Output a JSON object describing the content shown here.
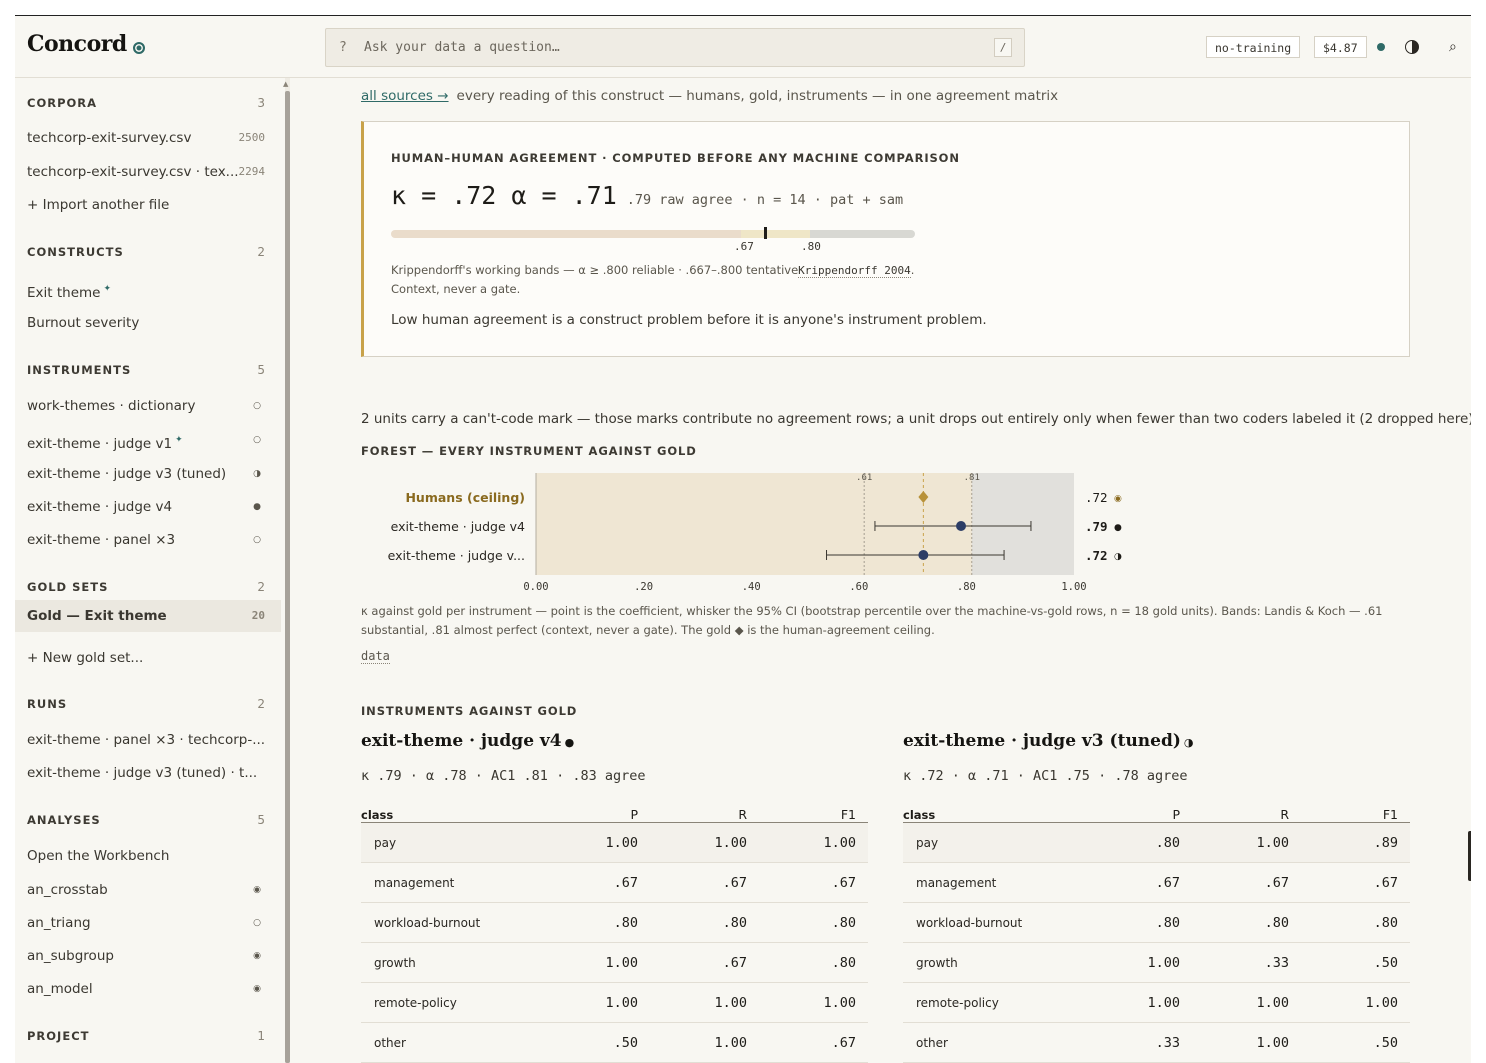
{
  "header": {
    "logo": "Concord",
    "search_prefix": "?",
    "search_placeholder": "Ask your data a question…",
    "search_shortcut": "/",
    "privacy_chip": "no-training",
    "cost_chip": "$4.87",
    "status_color": "#2f6a67"
  },
  "sidebar": {
    "sections": [
      {
        "title": "CORPORA",
        "count": "3",
        "items": [
          {
            "label": "techcorp-exit-survey.csv",
            "count": "2500"
          },
          {
            "label": "techcorp-exit-survey.csv · tex...",
            "count": "2294"
          },
          {
            "label": "+ Import another file"
          }
        ]
      },
      {
        "title": "CONSTRUCTS",
        "count": "2",
        "items": [
          {
            "label": "Exit theme",
            "star": "✦"
          },
          {
            "label": "Burnout severity"
          }
        ]
      },
      {
        "title": "INSTRUMENTS",
        "count": "5",
        "items": [
          {
            "label": "work-themes · dictionary",
            "indicator": "○"
          },
          {
            "label": "exit-theme · judge v1",
            "star": "✦",
            "indicator": "○"
          },
          {
            "label": "exit-theme · judge v3 (tuned)",
            "indicator": "◑"
          },
          {
            "label": "exit-theme · judge v4",
            "indicator": "●"
          },
          {
            "label": "exit-theme · panel ×3",
            "indicator": "○"
          }
        ]
      },
      {
        "title": "GOLD SETS",
        "count": "2",
        "items": [
          {
            "label": "Gold — Exit theme",
            "count": "20",
            "active": true
          },
          {
            "label": "+ New gold set..."
          }
        ]
      },
      {
        "title": "RUNS",
        "count": "2",
        "items": [
          {
            "label": "exit-theme · panel ×3 · techcorp-..."
          },
          {
            "label": "exit-theme · judge v3 (tuned) · t..."
          }
        ]
      },
      {
        "title": "ANALYSES",
        "count": "5",
        "items": [
          {
            "label": "Open the Workbench"
          },
          {
            "label": "an_crosstab",
            "indicator": "◉"
          },
          {
            "label": "an_triang",
            "indicator": "○"
          },
          {
            "label": "an_subgroup",
            "indicator": "◉"
          },
          {
            "label": "an_model",
            "indicator": "◉"
          }
        ]
      },
      {
        "title": "PROJECT",
        "count": "1",
        "items": []
      }
    ]
  },
  "main": {
    "breadcrumb_link": "all sources →",
    "breadcrumb_text": "every reading of this construct — humans, gold, instruments — in one agreement matrix",
    "agreement": {
      "title": "HUMAN–HUMAN AGREEMENT · COMPUTED BEFORE ANY MACHINE COMPARISON",
      "kappa_alpha": "κ = .72 α = .71",
      "sub": ".79 raw agree · n = 14 · pat + sam",
      "value": 0.72,
      "band_low": 0.667,
      "band_high": 0.8,
      "tick_low": ".67",
      "tick_high": ".80",
      "note": "Krippendorff's working bands — α ≥ .800 reliable · .667–.800 tentative",
      "citation": "Krippendorff 2004",
      "note_tail": ".",
      "note2": "Context, never a gate.",
      "message": "Low human agreement is a construct problem before it is anyone's instrument problem."
    },
    "cantcode_note": "2 units carry a can't-code mark — those marks contribute no agreement rows; a unit drops out entirely only when fewer than two coders labeled it (2 dropped here).",
    "forest_title": "FOREST — EVERY INSTRUMENT AGAINST GOLD",
    "forest_caption": "κ against gold per instrument — point is the coefficient, whisker the 95% CI (bootstrap percentile over the machine-vs-gold rows, n = 18 gold units). Bands: Landis & Koch — .61 substantial, .81 almost perfect (context, never a gate). The gold ◆ is the human-agreement ceiling.",
    "data_link": "data",
    "instruments_title": "INSTRUMENTS AGAINST GOLD",
    "instruments": [
      {
        "name": "exit-theme · judge v4",
        "indicator": "●",
        "stats": "κ .79 · α .78 · AC1 .81 · .83 agree",
        "headers": [
          "class",
          "P",
          "R",
          "F1"
        ],
        "rows": [
          [
            "pay",
            "1.00",
            "1.00",
            "1.00"
          ],
          [
            "management",
            ".67",
            ".67",
            ".67"
          ],
          [
            "workload-burnout",
            ".80",
            ".80",
            ".80"
          ],
          [
            "growth",
            "1.00",
            ".67",
            ".80"
          ],
          [
            "remote-policy",
            "1.00",
            "1.00",
            "1.00"
          ],
          [
            "other",
            ".50",
            "1.00",
            ".67"
          ]
        ]
      },
      {
        "name": "exit-theme · judge v3 (tuned)",
        "indicator": "◑",
        "stats": "κ .72 · α .71 · AC1 .75 · .78 agree",
        "headers": [
          "class",
          "P",
          "R",
          "F1"
        ],
        "rows": [
          [
            "pay",
            ".80",
            "1.00",
            ".89"
          ],
          [
            "management",
            ".67",
            ".67",
            ".67"
          ],
          [
            "workload-burnout",
            ".80",
            ".80",
            ".80"
          ],
          [
            "growth",
            "1.00",
            ".33",
            ".50"
          ],
          [
            "remote-policy",
            "1.00",
            "1.00",
            "1.00"
          ],
          [
            "other",
            ".33",
            "1.00",
            ".50"
          ]
        ]
      }
    ]
  },
  "chart_data": {
    "type": "scatter",
    "title": "FOREST — EVERY INSTRUMENT AGAINST GOLD",
    "xlim": [
      0,
      1
    ],
    "x_ticks": [
      "0.00",
      ".20",
      ".40",
      ".60",
      ".80",
      "1.00"
    ],
    "reference_lines": [
      {
        "x": 0.61,
        "label": ".61"
      },
      {
        "x": 0.81,
        "label": ".81"
      }
    ],
    "bands": [
      {
        "from": 0,
        "to": 0.81,
        "color": "#efe6d3"
      },
      {
        "from": 0.81,
        "to": 1.0,
        "color": "#e1e0dc"
      }
    ],
    "ceiling_line": 0.72,
    "rows": [
      {
        "label": "Humans (ceiling)",
        "value": 0.72,
        "value_label": ".72",
        "marker": "diamond",
        "indicator": "◉",
        "color": "#b8923a",
        "label_color": "#8a6a1f"
      },
      {
        "label": "exit-theme · judge v4",
        "value": 0.79,
        "ci": [
          0.63,
          0.92
        ],
        "value_label": ".79",
        "marker": "circle",
        "indicator": "●",
        "color": "#2c3d66"
      },
      {
        "label": "exit-theme · judge v...",
        "value": 0.72,
        "ci": [
          0.54,
          0.87
        ],
        "value_label": ".72",
        "marker": "circle",
        "indicator": "◑",
        "color": "#2c3d66"
      }
    ]
  }
}
